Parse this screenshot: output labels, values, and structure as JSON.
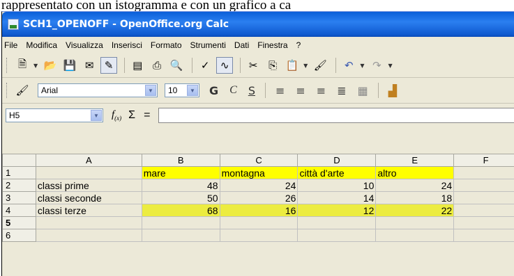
{
  "document": {
    "caption_fragment": "rappresentato con un istogramma e con un grafico a ca"
  },
  "window": {
    "title": "SCH1_OPENOFF - OpenOffice.org Calc"
  },
  "menu": [
    "File",
    "Modifica",
    "Visualizza",
    "Inserisci",
    "Formato",
    "Strumenti",
    "Dati",
    "Finestra",
    "?"
  ],
  "format_bar": {
    "font_name": "Arial",
    "font_size": "10",
    "bold_label": "G",
    "italic_label": "C",
    "underline_label": "S"
  },
  "input_line": {
    "cell_reference": "H5",
    "formula_value": ""
  },
  "columns": [
    "A",
    "B",
    "C",
    "D",
    "E",
    "F"
  ],
  "rows": [
    {
      "n": "1",
      "cells": [
        "",
        "mare",
        "montagna",
        "città d'arte",
        "altro",
        ""
      ]
    },
    {
      "n": "2",
      "cells": [
        "classi prime",
        "48",
        "24",
        "10",
        "24",
        ""
      ]
    },
    {
      "n": "3",
      "cells": [
        "classi seconde",
        "50",
        "26",
        "14",
        "18",
        ""
      ]
    },
    {
      "n": "4",
      "cells": [
        "classi terze",
        "68",
        "16",
        "12",
        "22",
        ""
      ]
    },
    {
      "n": "5",
      "cells": [
        "",
        "",
        "",
        "",
        "",
        ""
      ]
    },
    {
      "n": "6",
      "cells": [
        "",
        "",
        "",
        "",
        "",
        ""
      ]
    }
  ],
  "colors": {
    "header_highlight": "#ffff00",
    "row4_highlight": "#ecec40",
    "titlebar": "#0a5fd8"
  }
}
